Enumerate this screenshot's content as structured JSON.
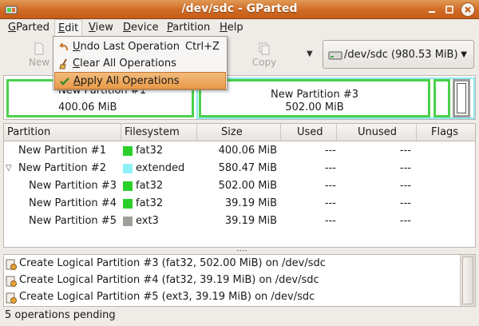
{
  "window": {
    "title": "/dev/sdc - GParted"
  },
  "menubar": {
    "items": [
      {
        "label": "GParted",
        "u": "G",
        "rest": "Parted"
      },
      {
        "label": "Edit",
        "u": "E",
        "rest": "dit"
      },
      {
        "label": "View",
        "u": "V",
        "rest": "iew"
      },
      {
        "label": "Device",
        "u": "D",
        "rest": "evice"
      },
      {
        "label": "Partition",
        "u": "P",
        "rest": "artition"
      },
      {
        "label": "Help",
        "u": "H",
        "rest": "elp"
      }
    ]
  },
  "toolbar": {
    "new_label": "New",
    "copy_label": "Copy"
  },
  "device_selector": {
    "value": "/dev/sdc  (980.53 MiB)"
  },
  "edit_menu": {
    "items": [
      {
        "u": "U",
        "rest": "ndo Last Operation",
        "accel": "Ctrl+Z",
        "icon": "undo-icon"
      },
      {
        "u": "C",
        "rest": "lear All Operations",
        "accel": "",
        "icon": "clear-icon"
      },
      {
        "u": "A",
        "rest": "pply All Operations",
        "accel": "",
        "icon": "apply-check-icon"
      }
    ]
  },
  "disk_map": {
    "p1": {
      "name": "New Partition #1",
      "size": "400.06 MiB"
    },
    "p3": {
      "name": "New Partition #3",
      "size": "502.00 MiB"
    }
  },
  "table": {
    "headers": [
      "Partition",
      "Filesystem",
      "Size",
      "Used",
      "Unused",
      "Flags"
    ],
    "rows": [
      {
        "partition": "New Partition #1",
        "filesystem": "fat32",
        "color": "#2ad02a",
        "size": "400.06 MiB",
        "used": "---",
        "unused": "---",
        "flags": "",
        "indent": 1,
        "expander": ""
      },
      {
        "partition": "New Partition #2",
        "filesystem": "extended",
        "color": "#8ff0f8",
        "size": "580.47 MiB",
        "used": "---",
        "unused": "---",
        "flags": "",
        "indent": 1,
        "expander": "▽"
      },
      {
        "partition": "New Partition #3",
        "filesystem": "fat32",
        "color": "#2ad02a",
        "size": "502.00 MiB",
        "used": "---",
        "unused": "---",
        "flags": "",
        "indent": 2,
        "expander": ""
      },
      {
        "partition": "New Partition #4",
        "filesystem": "fat32",
        "color": "#2ad02a",
        "size": "39.19 MiB",
        "used": "---",
        "unused": "---",
        "flags": "",
        "indent": 2,
        "expander": ""
      },
      {
        "partition": "New Partition #5",
        "filesystem": "ext3",
        "color": "#a19f9c",
        "size": "39.19 MiB",
        "used": "---",
        "unused": "---",
        "flags": "",
        "indent": 2,
        "expander": ""
      }
    ]
  },
  "operations": [
    "Create Logical Partition #3 (fat32, 502.00 MiB) on /dev/sdc",
    "Create Logical Partition #4 (fat32, 39.19 MiB) on /dev/sdc",
    "Create Logical Partition #5 (ext3, 39.19 MiB) on /dev/sdc"
  ],
  "status": "5 operations pending",
  "colors": {
    "accent": "#e99a47",
    "fat32": "#2ad02a",
    "extended": "#8ff0f8",
    "ext3": "#a19f9c"
  }
}
